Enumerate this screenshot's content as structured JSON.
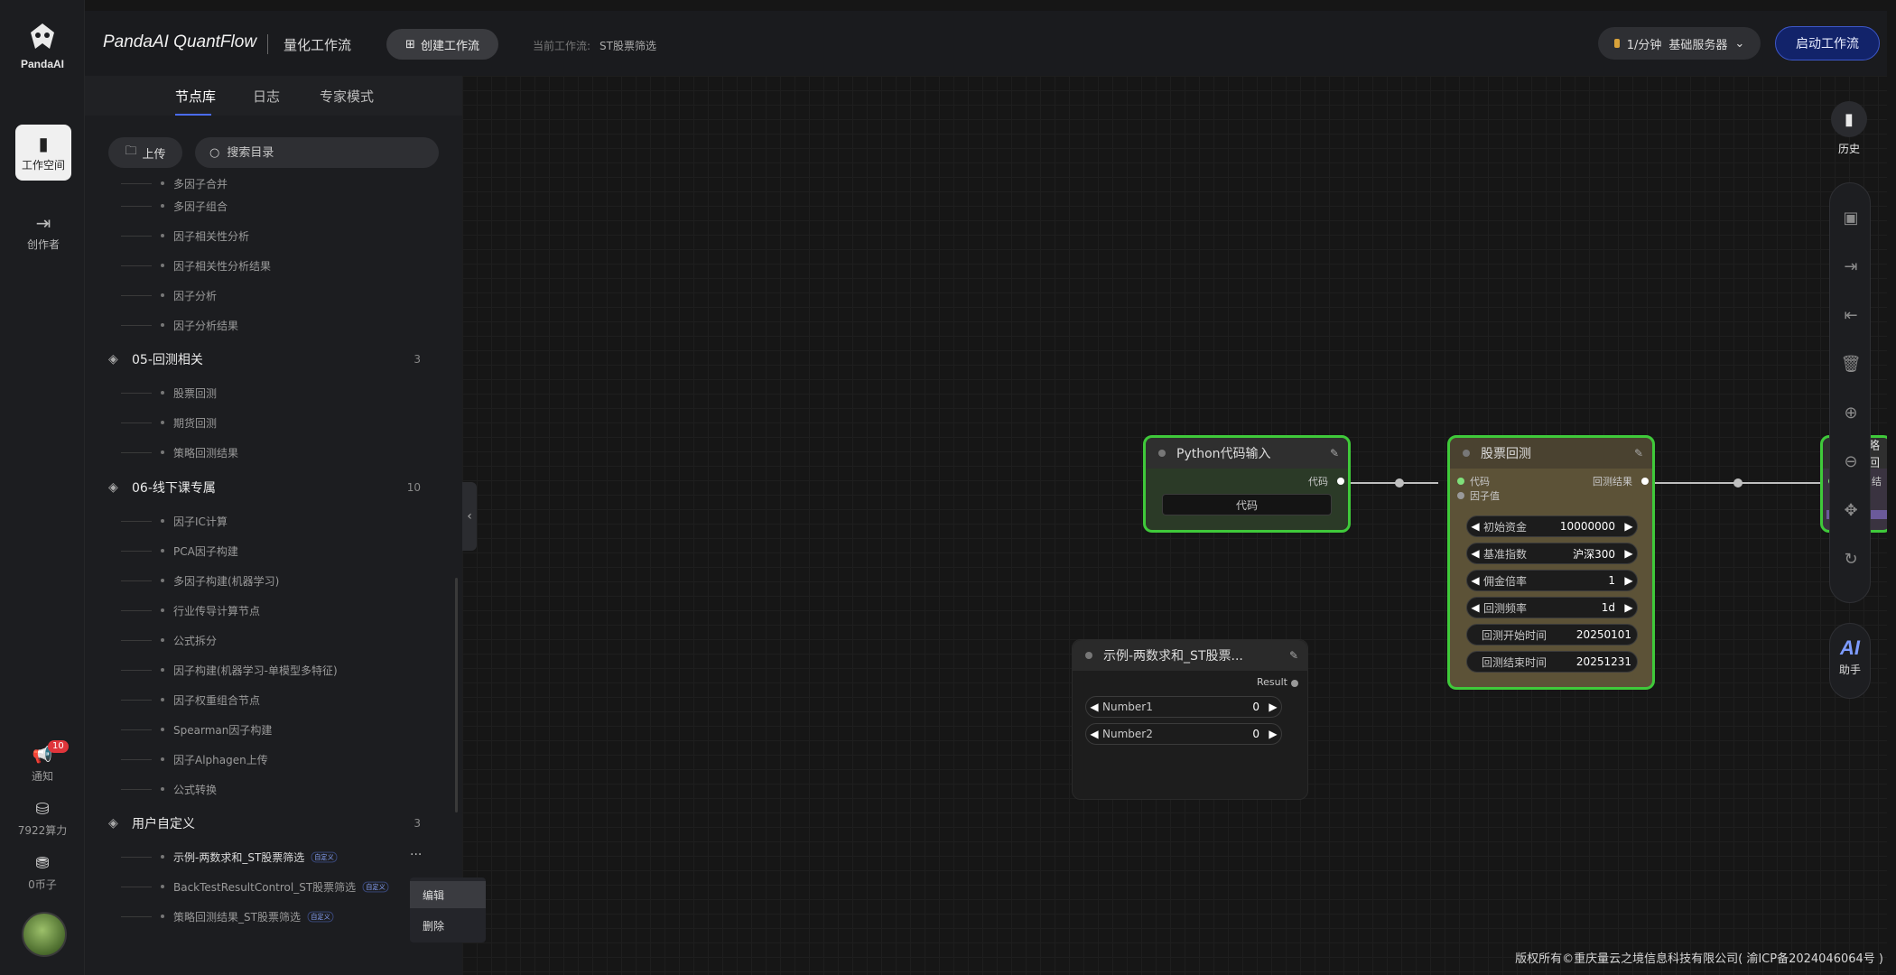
{
  "rail": {
    "logo_text": "PandaAI",
    "workspace_label": "工作空间",
    "creator_label": "创作者",
    "notify_label": "通知",
    "notify_count": "10",
    "compute_label": "7922算力",
    "factor_label": "0币子"
  },
  "topbar": {
    "brand": "PandaAI QuantFlow",
    "subtitle": "量化工作流",
    "create_label": "创建工作流",
    "current_label": "当前工作流:",
    "current_value": "ST股票筛选",
    "plan_label": "1/分钟",
    "server_label": "基础服务器",
    "start_label": "启动工作流"
  },
  "panel": {
    "tabs": [
      "节点库",
      "日志",
      "专家模式"
    ],
    "upload_label": "上传",
    "search_placeholder": "搜索目录",
    "top_items": [
      "多因子合并",
      "多因子组合",
      "因子相关性分析",
      "因子相关性分析结果",
      "因子分析",
      "因子分析结果"
    ],
    "group_backtest": {
      "name": "05-回测相关",
      "count": "3",
      "items": [
        "股票回测",
        "期货回测",
        "策略回测结果"
      ]
    },
    "group_offline": {
      "name": "06-线下课专属",
      "count": "10",
      "items": [
        "因子IC计算",
        "PCA因子构建",
        "多因子构建(机器学习)",
        "行业传导计算节点",
        "公式拆分",
        "因子构建(机器学习-单模型多特征)",
        "因子权重组合节点",
        "Spearman因子构建",
        "因子Alphagen上传",
        "公式转换"
      ]
    },
    "group_custom": {
      "name": "用户自定义",
      "count": "3",
      "items": [
        "示例-两数求和_ST股票筛选",
        "BackTestResultControl_ST股票筛选",
        "策略回测结果_ST股票筛选"
      ],
      "tag": "自定义"
    },
    "more_icon": "···",
    "context_menu": [
      "编辑",
      "删除"
    ]
  },
  "nodes": {
    "python": {
      "title": "Python代码输入",
      "out_port": "代码",
      "field": "代码"
    },
    "backtest": {
      "title": "股票回测",
      "in_ports": [
        "代码",
        "因子值"
      ],
      "out_port": "回测结果",
      "fields": [
        {
          "label": "初始资金",
          "value": "10000000"
        },
        {
          "label": "基准指数",
          "value": "沪深300"
        },
        {
          "label": "佣金倍率",
          "value": "1"
        },
        {
          "label": "回测频率",
          "value": "1d"
        }
      ],
      "plain_fields": [
        {
          "label": "回测开始时间",
          "value": "20250101"
        },
        {
          "label": "回测结束时间",
          "value": "20251231"
        }
      ]
    },
    "sum": {
      "title": "示例-两数求和_ST股票...",
      "out_port": "Result",
      "fields": [
        {
          "label": "Number1",
          "value": "0"
        },
        {
          "label": "Number2",
          "value": "0"
        }
      ]
    },
    "partial": {
      "title": "略回",
      "out": "结"
    }
  },
  "toolbar": {
    "history_label": "历史",
    "ai_label": "AI",
    "assistant_label": "助手"
  },
  "footer": "版权所有©重庆量云之境信息科技有限公司( 渝ICP备2024046064号 )",
  "colors": {
    "accent": "#4a6cf7",
    "node_border": "#3fc93a",
    "backtest_bg": "#5c5237",
    "start_btn": "#12236a"
  }
}
